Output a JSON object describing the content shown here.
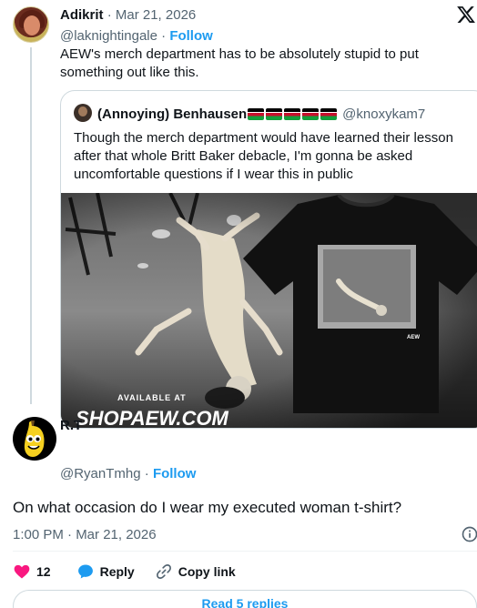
{
  "parent_tweet": {
    "author_name": "Adikrit",
    "date": "Mar 21, 2026",
    "handle": "@laknightingale",
    "follow_label": "Follow",
    "text": "AEW's merch department has to be absolutely stupid to put something out like this.",
    "logo_icon": "x-logo-icon"
  },
  "quoted_tweet": {
    "author_name": "(Annoying) Benhausen",
    "handle": "@knoxykam7",
    "flag_icon": "kenya-flag-icon",
    "flag_count": 5,
    "text": "Though the merch department would have learned their lesson after that whole Britt Baker debacle, I'm gonna be asked uncomfortable questions if I wear this in public",
    "media": {
      "banner_line1": "AVAILABLE AT",
      "banner_brand": "SHOPAEW.COM",
      "shirt_tag": "AEW"
    }
  },
  "reply_tweet": {
    "author_name": "R.T",
    "handle": "@RyanTmhg",
    "follow_label": "Follow",
    "text": "On what occasion do I wear my executed woman t-shirt?",
    "time": "1:00 PM · Mar 21, 2026",
    "like_count": "12",
    "reply_label": "Reply",
    "copy_label": "Copy link",
    "read_replies_label": "Read 5 replies"
  },
  "colors": {
    "accent": "#1d9bf0",
    "like": "#f91880",
    "muted": "#536471",
    "text": "#0f1419",
    "border": "#cfd9de"
  }
}
